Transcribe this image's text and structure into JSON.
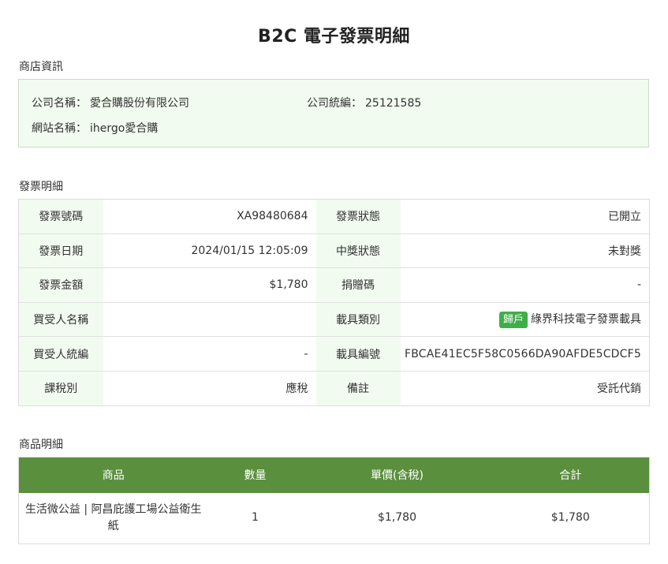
{
  "title": "B2C 電子發票明細",
  "store": {
    "section_title": "商店資訊",
    "company_name_label": "公司名稱：",
    "company_name": "愛合購股份有限公司",
    "tax_id_label": "公司統編：",
    "tax_id": "25121585",
    "site_name_label": "網站名稱：",
    "site_name": "ihergo愛合購"
  },
  "invoice": {
    "section_title": "發票明細",
    "rows": [
      {
        "k1": "發票號碼",
        "v1": "XA98480684",
        "k2": "發票狀態",
        "v2": "已開立"
      },
      {
        "k1": "發票日期",
        "v1": "2024/01/15 12:05:09",
        "k2": "中獎狀態",
        "v2": "未對獎"
      },
      {
        "k1": "發票金額",
        "v1": "$1,780",
        "k2": "捐贈碼",
        "v2": "-"
      },
      {
        "k1": "買受人名稱",
        "v1": "",
        "k2": "載具類別",
        "badge": "歸戶",
        "v2": "綠界科技電子發票載具"
      },
      {
        "k1": "買受人統編",
        "v1": "-",
        "k2": "載具編號",
        "v2": "FBCAE41EC5F58C0566DA90AFDE5CDCF5"
      },
      {
        "k1": "課稅別",
        "v1": "應稅",
        "k2": "備註",
        "v2": "受託代銷"
      }
    ]
  },
  "items": {
    "section_title": "商品明細",
    "headers": [
      "商品",
      "數量",
      "單價(含稅)",
      "合計"
    ],
    "rows": [
      {
        "name": "生活微公益 | 阿昌庇護工場公益衛生紙",
        "qty": "1",
        "price": "$1,780",
        "total": "$1,780"
      }
    ]
  },
  "colors": {
    "header_green": "#5a8f3e",
    "label_bg": "#f1fbef",
    "badge_green": "#3fae49"
  }
}
